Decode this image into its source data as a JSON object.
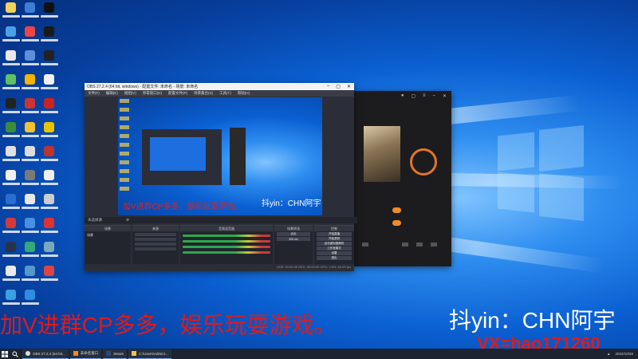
{
  "overlay": {
    "left_caption": "加V进群CP多多，娱乐玩耍游戏。",
    "right_caption": "抖yin：CHN阿宇",
    "vx_caption": "VX=hao171260",
    "left_color": "#e01a1a",
    "right_color": "#ffffff"
  },
  "obs": {
    "title": "OBS 27.2.4 (64 bit, windows) - 配置文件: 未命名 - 场景: 未命名",
    "menu": [
      "文件(F)",
      "编辑(E)",
      "视图(V)",
      "停靠窗口(D)",
      "配置文件(P)",
      "场景集合(S)",
      "工具(T)",
      "帮助(H)"
    ],
    "preview_caption_left": "加V进群CP多多，娱乐玩耍游戏。",
    "preview_caption_right": "抖yin：CHN阿宇",
    "strip_label": "未选择源",
    "docks": {
      "scenes": "场景",
      "sources": "来源",
      "mixer": "音频混音器",
      "transitions": "场景转场",
      "controls": "控制"
    },
    "scene_item": "场景",
    "transition_label": "淡出",
    "transition_duration": "300 ms",
    "controls": [
      "开始直播",
      "开始录制",
      "启动虚拟摄像机",
      "工作室模式",
      "设置",
      "退出"
    ],
    "status": "LIVE: 00:00:00   REC: 00:00:00   CPU: 1.5%, 60.00 fps"
  },
  "taskbar": {
    "tasks": [
      {
        "label": "OBS 27.2.4 (64 bit...",
        "icon": "obs-icon"
      },
      {
        "label": "未命名窗口",
        "icon": "app-icon"
      },
      {
        "label": "Steam",
        "icon": "steam-icon"
      },
      {
        "label": "C:\\Users\\Admin\\...",
        "icon": "folder-icon"
      }
    ],
    "date": "2022/10/26"
  },
  "colors": {
    "desktop_blue": "#0a5fd1",
    "obs_bg": "#2b2e38",
    "accent_orange": "#e2752c"
  }
}
